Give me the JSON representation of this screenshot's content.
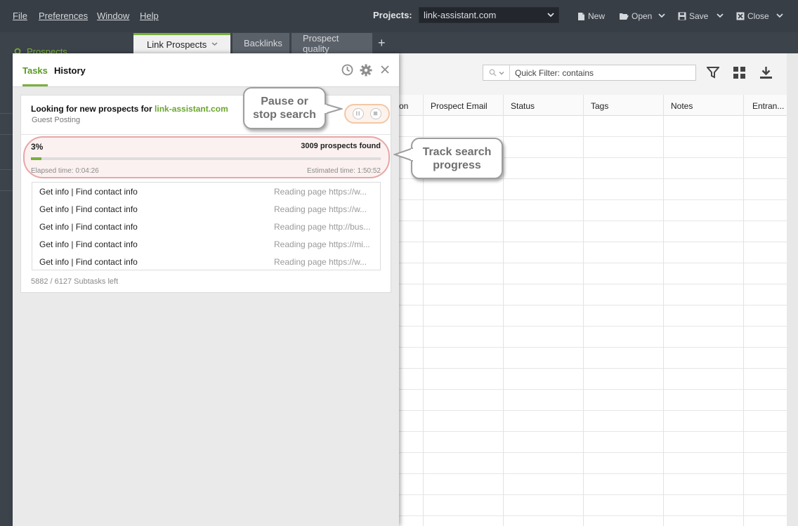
{
  "menu": {
    "file": "File",
    "preferences": "Preferences",
    "window": "Window",
    "help": "Help"
  },
  "projects": {
    "label": "Projects:",
    "selected": "link-assistant.com"
  },
  "toolbar": {
    "new_label": "New",
    "open_label": "Open",
    "save_label": "Save",
    "close_label": "Close"
  },
  "leftnav": {
    "prospects_label": "Prospects"
  },
  "tabs": [
    {
      "label": "Link Prospects",
      "active": true
    },
    {
      "label": "Backlinks",
      "active": false
    },
    {
      "label": "Prospect quality",
      "active": false
    }
  ],
  "quick_filter": {
    "placeholder": "Quick Filter: contains"
  },
  "grid": {
    "columns": [
      "on",
      "Prospect Email",
      "Status",
      "Tags",
      "Notes",
      "Entran..."
    ]
  },
  "tasks_panel": {
    "tab_tasks": "Tasks",
    "tab_history": "History",
    "task": {
      "title_prefix": "Looking for new prospects for",
      "project": "link-assistant.com",
      "subtitle": "Guest Posting",
      "progress_text": "3%",
      "progress_fraction": 0.03,
      "found": "3009 prospects found",
      "elapsed": "Elapsed time:  0:04:26",
      "estimated": "Estimated time:  1:50:52",
      "subtasks": [
        {
          "name": "Get info | Find contact info",
          "status": "Reading page https://w..."
        },
        {
          "name": "Get info | Find contact info",
          "status": "Reading page https://w..."
        },
        {
          "name": "Get info | Find contact info",
          "status": "Reading page http://bus..."
        },
        {
          "name": "Get info | Find contact info",
          "status": "Reading page https://mi..."
        },
        {
          "name": "Get info | Find contact info",
          "status": "Reading page https://w..."
        }
      ],
      "subtasks_left": "5882 / 6127 Subtasks left"
    }
  },
  "callouts": {
    "pause_line1": "Pause or",
    "pause_line2": "stop search",
    "track_line1": "Track search",
    "track_line2": "progress"
  },
  "colors": {
    "accent": "#7ab03c",
    "chrome": "#383e46",
    "pause_highlight": "#f3c7a6",
    "progress_highlight": "#e8a6a6"
  }
}
